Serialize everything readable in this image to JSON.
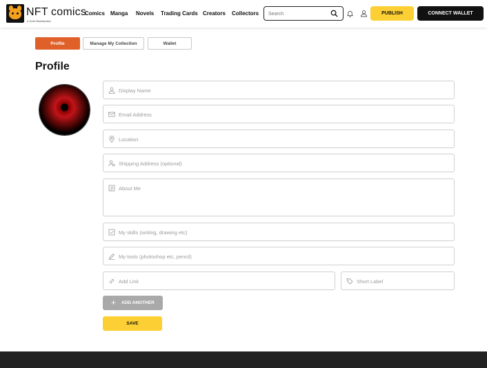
{
  "header": {
    "logo_text": "NFT comics",
    "logo_sub": "a Getir Marketplace",
    "nav": [
      "Comics",
      "Manga",
      "Novels",
      "Trading Cards",
      "Creators",
      "Collectors"
    ],
    "search_placeholder": "Search",
    "publish_label": "PUBLISH",
    "connect_label": "CONNECT WALLET"
  },
  "tabs": [
    "Profile",
    "Manage My Collection",
    "Wallet"
  ],
  "page_title": "Profile",
  "form": {
    "display_name": "Display Name",
    "email": "Email Address",
    "location": "Location",
    "shipping": "Shipping Address (optional)",
    "about": "About Me",
    "skills": "My skills (writing, drawing etc)",
    "tools": "My tools (photoshop etc, pencil)",
    "add_link": "Add Link",
    "short_label": "Short Label",
    "add_another": "ADD ANOTHER",
    "save": "SAVE"
  },
  "colors": {
    "accent": "#e0602a",
    "yellow": "#fcd034",
    "dark": "#111111"
  }
}
